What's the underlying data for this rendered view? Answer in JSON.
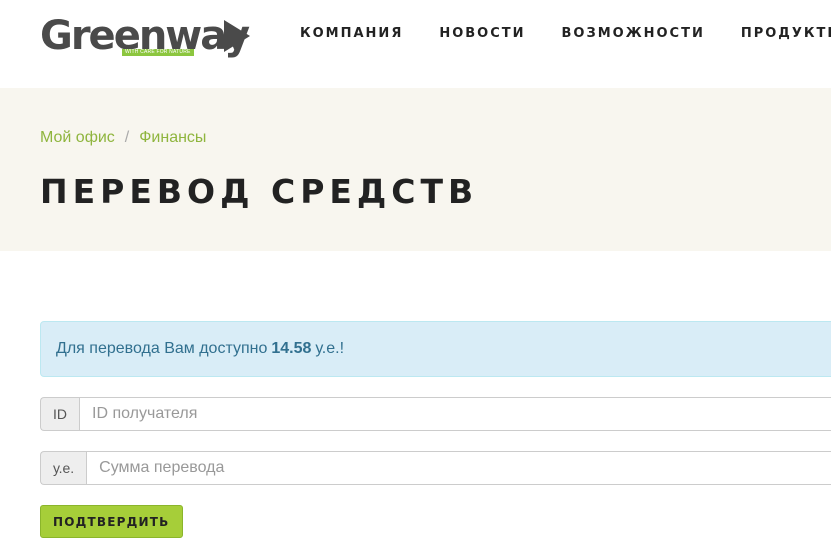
{
  "logo": {
    "text": "Greenway",
    "tagline": "WITH CARE FOR NATURE"
  },
  "nav": {
    "items": [
      {
        "label": "КОМПАНИЯ"
      },
      {
        "label": "НОВОСТИ"
      },
      {
        "label": "ВОЗМОЖНОСТИ"
      },
      {
        "label": "ПРОДУКТЫ"
      }
    ]
  },
  "breadcrumb": {
    "items": [
      {
        "label": "Мой офис"
      },
      {
        "label": "Финансы"
      }
    ],
    "separator": "/"
  },
  "page": {
    "title": "ПЕРЕВОД СРЕДСТВ"
  },
  "alert": {
    "prefix": "Для перевода Вам доступно",
    "amount": "14.58",
    "suffix": "у.е.!"
  },
  "form": {
    "recipient": {
      "addon": "ID",
      "value": "",
      "placeholder": "ID получателя"
    },
    "amount": {
      "addon": "у.е.",
      "value": "",
      "placeholder": "Сумма перевода"
    },
    "submit_label": "ПОДТВЕРДИТЬ"
  },
  "colors": {
    "brand_green": "#a6ce39",
    "link_green": "#8fb53e",
    "title_band": "#f8f6ef",
    "alert_bg": "#d9edf7",
    "alert_text": "#31708f"
  }
}
